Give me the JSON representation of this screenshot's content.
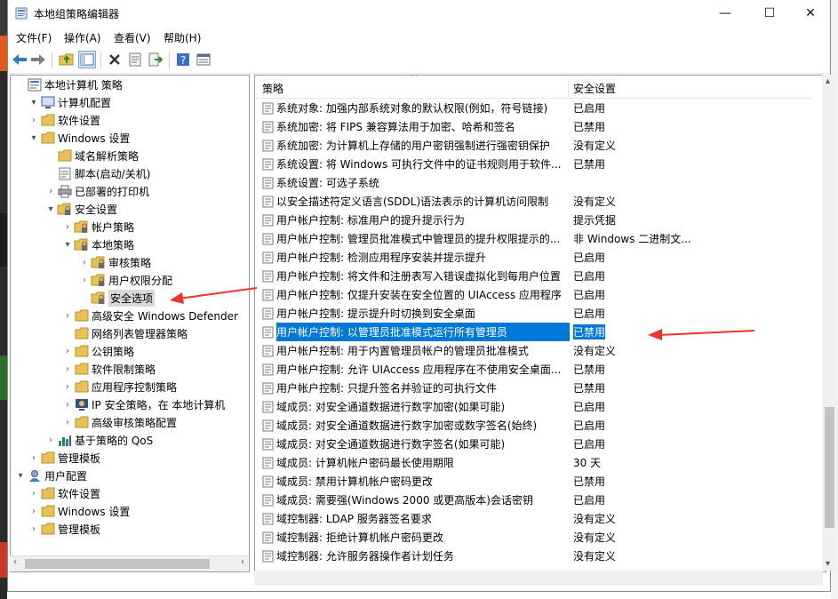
{
  "window": {
    "title": "本地组策略编辑器",
    "controls": {
      "minimize": "—",
      "maximize": "☐",
      "close": "✕"
    }
  },
  "menu": [
    "文件(F)",
    "操作(A)",
    "查看(V)",
    "帮助(H)"
  ],
  "toolbar_icons": [
    "back-icon",
    "forward-icon",
    "up-folder-icon",
    "show-tree-icon",
    "delete-icon",
    "properties-icon",
    "export-icon",
    "help-icon",
    "view-icon"
  ],
  "tree": [
    {
      "label": "本地计算机 策略",
      "icon": "policy-icon",
      "expander": ""
    },
    {
      "label": "计算机配置",
      "icon": "computer-icon",
      "expander": "▾"
    },
    {
      "label": "软件设置",
      "icon": "folder-icon",
      "expander": "›"
    },
    {
      "label": "Windows 设置",
      "icon": "folder-icon",
      "expander": "▾"
    },
    {
      "label": "域名解析策略",
      "icon": "folder-icon",
      "expander": ""
    },
    {
      "label": "脚本(启动/关机)",
      "icon": "script-icon",
      "expander": ""
    },
    {
      "label": "已部署的打印机",
      "icon": "printer-icon",
      "expander": "›"
    },
    {
      "label": "安全设置",
      "icon": "security-folder-icon",
      "expander": "▾"
    },
    {
      "label": "帐户策略",
      "icon": "security-folder-icon",
      "expander": "›"
    },
    {
      "label": "本地策略",
      "icon": "security-folder-icon",
      "expander": "▾"
    },
    {
      "label": "审核策略",
      "icon": "security-folder-icon",
      "expander": "›"
    },
    {
      "label": "用户权限分配",
      "icon": "security-folder-icon",
      "expander": "›"
    },
    {
      "label": "安全选项",
      "icon": "security-folder-icon",
      "expander": ""
    },
    {
      "label": "高级安全 Windows Defender",
      "icon": "folder-icon",
      "expander": "›"
    },
    {
      "label": "网络列表管理器策略",
      "icon": "folder-icon",
      "expander": ""
    },
    {
      "label": "公钥策略",
      "icon": "folder-icon",
      "expander": "›"
    },
    {
      "label": "软件限制策略",
      "icon": "folder-icon",
      "expander": "›"
    },
    {
      "label": "应用程序控制策略",
      "icon": "folder-icon",
      "expander": "›"
    },
    {
      "label": "IP 安全策略，在 本地计算机",
      "icon": "ip-security-icon",
      "expander": "›"
    },
    {
      "label": "高级审核策略配置",
      "icon": "folder-icon",
      "expander": "›"
    },
    {
      "label": "基于策略的 QoS",
      "icon": "chart-icon",
      "expander": "›"
    },
    {
      "label": "管理模板",
      "icon": "folder-icon",
      "expander": "›"
    },
    {
      "label": "用户配置",
      "icon": "user-icon",
      "expander": "▾"
    },
    {
      "label": "软件设置",
      "icon": "folder-icon",
      "expander": "›"
    },
    {
      "label": "Windows 设置",
      "icon": "folder-icon",
      "expander": "›"
    },
    {
      "label": "管理模板",
      "icon": "folder-icon",
      "expander": "›"
    }
  ],
  "list": {
    "columns": {
      "policy": "策略",
      "setting": "安全设置"
    },
    "rows": [
      {
        "name": "系统对象: 加强内部系统对象的默认权限(例如，符号链接)",
        "setting": "已启用"
      },
      {
        "name": "系统加密: 将 FIPS 兼容算法用于加密、哈希和签名",
        "setting": "已禁用"
      },
      {
        "name": "系统加密: 为计算机上存储的用户密钥强制进行强密钥保护",
        "setting": "没有定义"
      },
      {
        "name": "系统设置: 将 Windows 可执行文件中的证书规则用于软件...",
        "setting": "已禁用"
      },
      {
        "name": "系统设置: 可选子系统",
        "setting": ""
      },
      {
        "name": "以安全描述符定义语言(SDDL)语法表示的计算机访问限制",
        "setting": "没有定义"
      },
      {
        "name": "用户帐户控制: 标准用户的提升提示行为",
        "setting": "提示凭据"
      },
      {
        "name": "用户帐户控制: 管理员批准模式中管理员的提升权限提示的...",
        "setting": "非 Windows 二进制文..."
      },
      {
        "name": "用户帐户控制: 检测应用程序安装并提示提升",
        "setting": "已启用"
      },
      {
        "name": "用户帐户控制: 将文件和注册表写入错误虚拟化到每用户位置",
        "setting": "已启用"
      },
      {
        "name": "用户帐户控制: 仅提升安装在安全位置的 UIAccess 应用程序",
        "setting": "已启用"
      },
      {
        "name": "用户帐户控制: 提示提升时切换到安全桌面",
        "setting": "已启用"
      },
      {
        "name": "用户帐户控制: 以管理员批准模式运行所有管理员",
        "setting": "已禁用"
      },
      {
        "name": "用户帐户控制: 用于内置管理员帐户的管理员批准模式",
        "setting": "没有定义"
      },
      {
        "name": "用户帐户控制: 允许 UIAccess 应用程序在不使用安全桌面...",
        "setting": "已禁用"
      },
      {
        "name": "用户帐户控制: 只提升签名并验证的可执行文件",
        "setting": "已禁用"
      },
      {
        "name": "域成员: 对安全通道数据进行数字加密(如果可能)",
        "setting": "已启用"
      },
      {
        "name": "域成员: 对安全通道数据进行数字加密或数字签名(始终)",
        "setting": "已启用"
      },
      {
        "name": "域成员: 对安全通道数据进行数字签名(如果可能)",
        "setting": "已启用"
      },
      {
        "name": "域成员: 计算机帐户密码最长使用期限",
        "setting": "30 天"
      },
      {
        "name": "域成员: 禁用计算机帐户密码更改",
        "setting": "已禁用"
      },
      {
        "name": "域成员: 需要强(Windows 2000 或更高版本)会话密钥",
        "setting": "已启用"
      },
      {
        "name": "域控制器: LDAP 服务器签名要求",
        "setting": "没有定义"
      },
      {
        "name": "域控制器: 拒绝计算机帐户密码更改",
        "setting": "没有定义"
      },
      {
        "name": "域控制器: 允许服务器操作者计划任务",
        "setting": "没有定义"
      }
    ]
  },
  "selection": {
    "tree_label": "安全选项",
    "list_row": "用户帐户控制: 以管理员批准模式运行所有管理员"
  },
  "colors": {
    "selection": "#0078d7",
    "annotation_arrow": "#e8362d",
    "folder": "#e8c15a"
  }
}
